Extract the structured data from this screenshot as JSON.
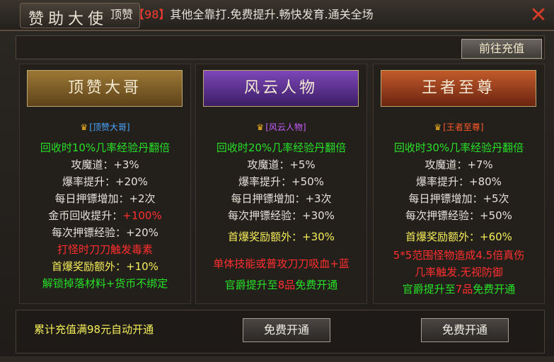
{
  "window": {
    "title": "赞助大使",
    "close_icon": "close-x-icon"
  },
  "banner": {
    "prefix": "顶赞",
    "highlight": "【98】",
    "suffix": "其他全靠打.免费提升.畅快发育.通关全场",
    "recharge_button": "前往充值"
  },
  "tiers": [
    {
      "name": "顶赞大哥",
      "badge": "[顶赞大哥]",
      "lines": [
        {
          "text": "回收时10%几率经验丹翻倍",
          "color": "green"
        },
        {
          "text": "攻魔道：+3%",
          "color": "white"
        },
        {
          "text": "爆率提升：+20%",
          "color": "white"
        },
        {
          "text": "每日押镖增加：+2次",
          "color": "white"
        },
        {
          "text": "金币回收提升：",
          "value": "+100%",
          "color": "white"
        }
      ],
      "extra": [
        {
          "text": "每次押镖经验：+20%",
          "color": "white"
        },
        {
          "text": "打怪时刀刀触发毒素",
          "color": "red"
        },
        {
          "text": "首爆奖励额外：+10%",
          "color": "yellow"
        },
        {
          "text": "解锁掉落材料+货币不绑定",
          "color": "green"
        }
      ]
    },
    {
      "name": "风云人物",
      "badge": "[风云人物]",
      "lines": [
        {
          "text": "回收时20%几率经验丹翻倍",
          "color": "green"
        },
        {
          "text": "攻魔道：+5%",
          "color": "white"
        },
        {
          "text": "爆率提升：+50%",
          "color": "white"
        },
        {
          "text": "每日押镖增加：+3次",
          "color": "white"
        },
        {
          "text": "每次押镖经验：+30%",
          "color": "white"
        }
      ],
      "extra": [
        {
          "text": "首爆奖励额外：+30%",
          "color": "yellow"
        },
        {
          "text": "单体技能或普攻刀刀吸血+蓝",
          "color": "red"
        },
        {
          "text_a": "官爵提升至",
          "text_b": "8品",
          "text_c": "免费开通",
          "color": "green"
        }
      ]
    },
    {
      "name": "王者至尊",
      "badge": "[王者至尊]",
      "lines": [
        {
          "text": "回收时30%几率经验丹翻倍",
          "color": "green"
        },
        {
          "text": "攻魔道：+7%",
          "color": "white"
        },
        {
          "text": "爆率提升：+80%",
          "color": "white"
        },
        {
          "text": "每日押镖增加：+5次",
          "color": "white"
        },
        {
          "text": "每次押镖经验：+50%",
          "color": "white"
        }
      ],
      "extra": [
        {
          "text": "首爆奖励额外：+60%",
          "color": "yellow"
        },
        {
          "text": "5*5范围怪物造成4.5倍真伤",
          "color": "red"
        },
        {
          "text": "几率触发.无视防御",
          "color": "red"
        },
        {
          "text_a": "官爵提升至",
          "text_b": "7品",
          "text_c": "免费开通",
          "color": "green"
        }
      ]
    }
  ],
  "footer": {
    "auto_text": "累计充值满98元自动开通",
    "free_button_1": "免费开通",
    "free_button_2": "免费开通"
  }
}
